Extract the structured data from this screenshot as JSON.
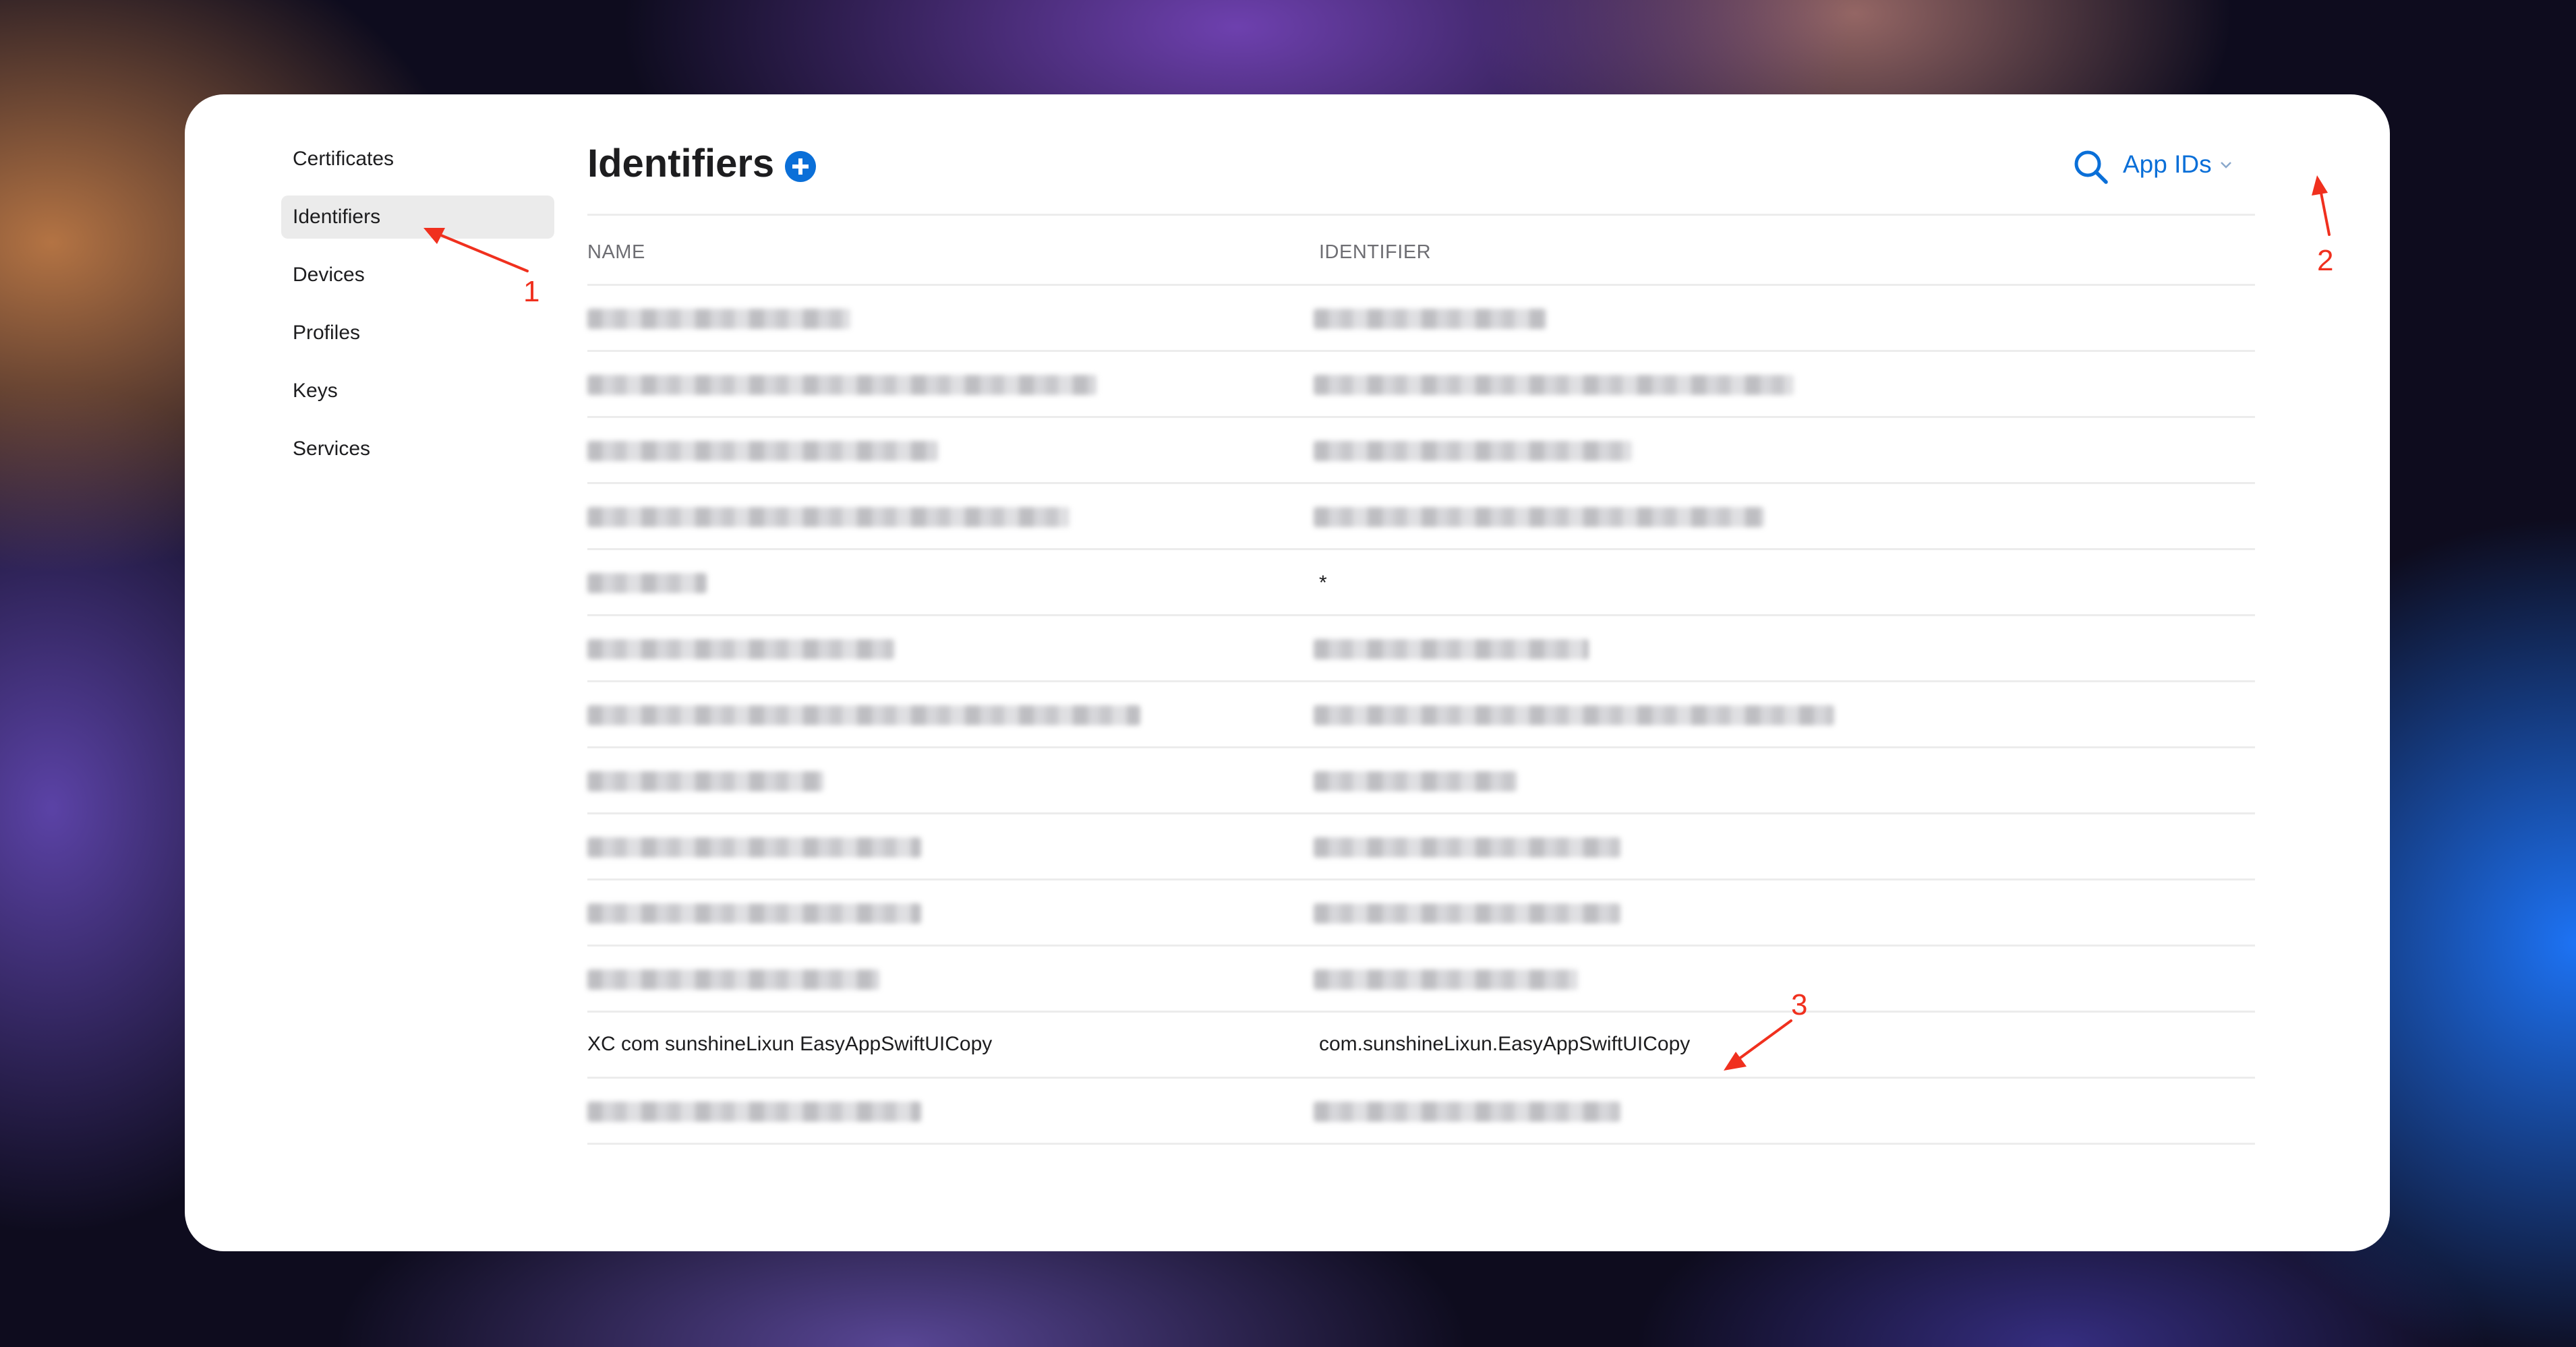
{
  "sidebar": {
    "items": [
      {
        "label": "Certificates",
        "active": false
      },
      {
        "label": "Identifiers",
        "active": true
      },
      {
        "label": "Devices",
        "active": false
      },
      {
        "label": "Profiles",
        "active": false
      },
      {
        "label": "Keys",
        "active": false
      },
      {
        "label": "Services",
        "active": false
      }
    ]
  },
  "header": {
    "title": "Identifiers",
    "filter_label": "App IDs"
  },
  "table": {
    "headers": [
      "NAME",
      "IDENTIFIER"
    ],
    "rows": [
      {
        "name": "",
        "identifier": "",
        "redacted": true
      },
      {
        "name": "",
        "identifier": "",
        "redacted": true
      },
      {
        "name": "",
        "identifier": "",
        "redacted": true
      },
      {
        "name": "",
        "identifier": "",
        "redacted": true
      },
      {
        "name": "",
        "identifier": "*",
        "redacted": true
      },
      {
        "name": "",
        "identifier": "",
        "redacted": true
      },
      {
        "name": "",
        "identifier": "",
        "redacted": true
      },
      {
        "name": "",
        "identifier": "",
        "redacted": true
      },
      {
        "name": "",
        "identifier": "",
        "redacted": true
      },
      {
        "name": "",
        "identifier": "",
        "redacted": true
      },
      {
        "name": "",
        "identifier": "",
        "redacted": true
      },
      {
        "name": "XC com sunshineLixun EasyAppSwiftUICopy",
        "identifier": "com.sunshineLixun.EasyAppSwiftUICopy",
        "redacted": false
      },
      {
        "name": "",
        "identifier": "",
        "redacted": true
      }
    ]
  },
  "annotations": {
    "step1": "1",
    "step2": "2",
    "step3": "3"
  },
  "colors": {
    "accent": "#0a6fd8",
    "annotation": "#f0301e"
  },
  "icons": {
    "add": "plus-circle-icon",
    "search": "search-icon",
    "dropdown": "chevron-down-icon"
  }
}
